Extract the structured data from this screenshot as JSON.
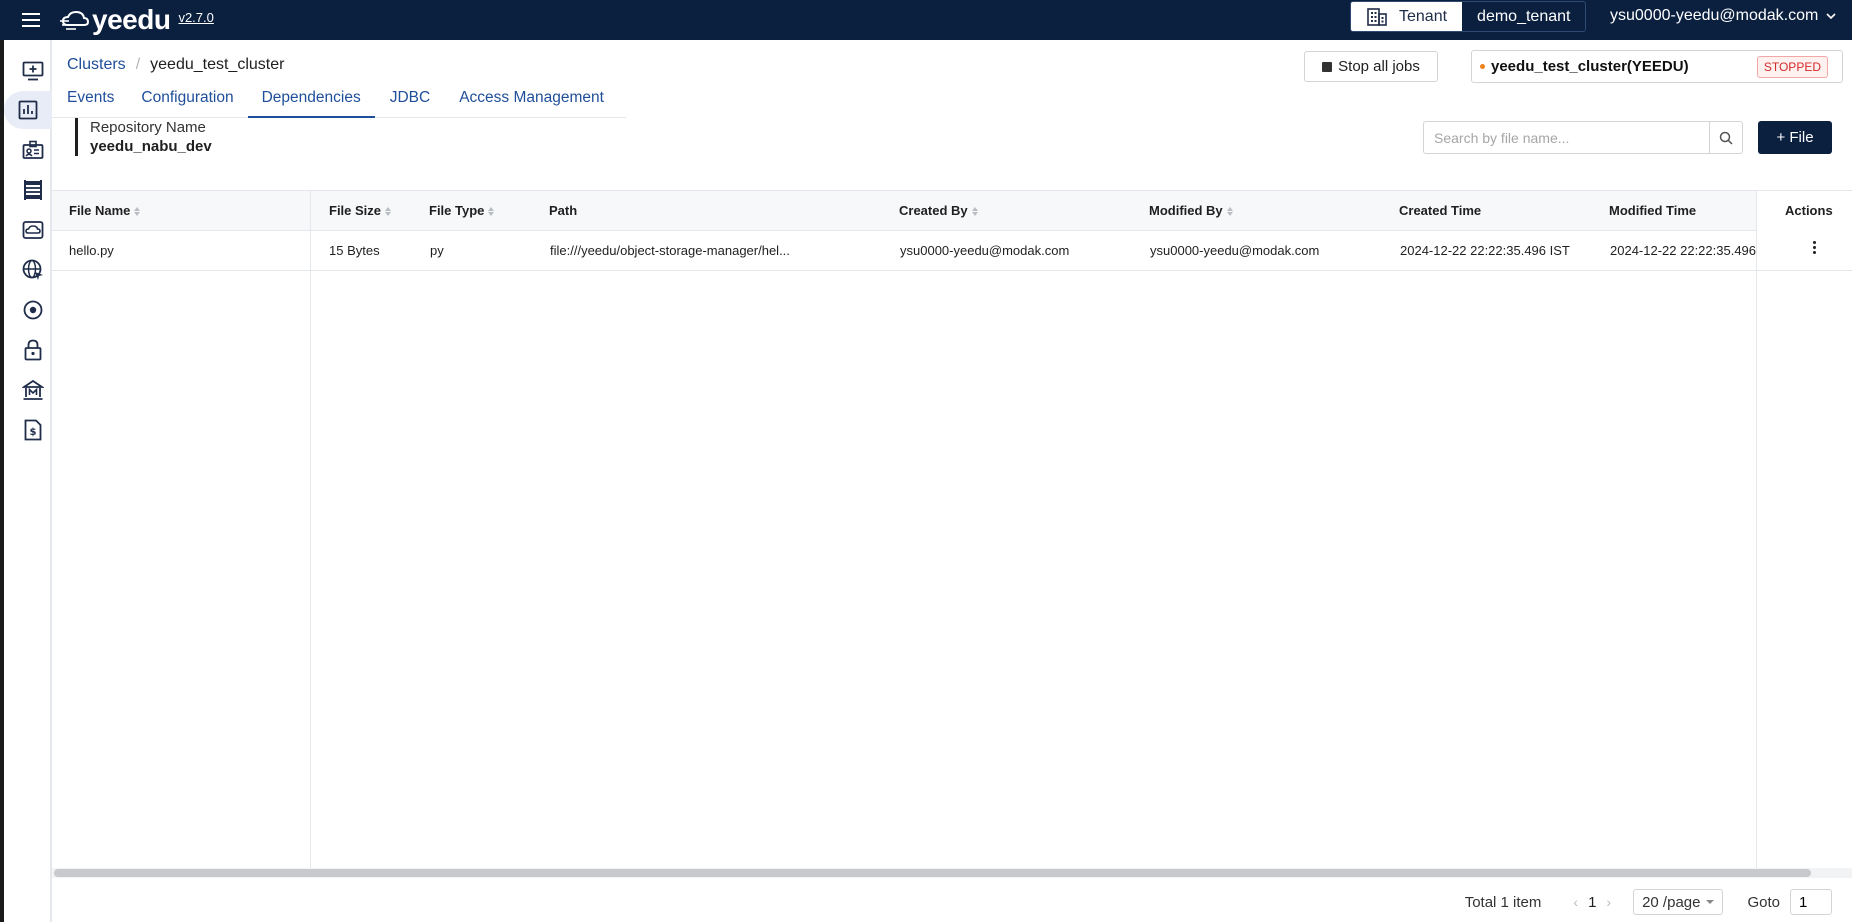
{
  "header": {
    "app_name": "yeedu",
    "version": "v2.7.0",
    "tenant_label": "Tenant",
    "tenant_name": "demo_tenant",
    "user_email": "ysu0000-yeedu@modak.com"
  },
  "sidebar": {
    "items": [
      {
        "icon": "add-screen-icon",
        "active": false
      },
      {
        "icon": "bar-chart-icon",
        "active": true
      },
      {
        "icon": "id-card-icon",
        "active": false
      },
      {
        "icon": "server-rack-icon",
        "active": false
      },
      {
        "icon": "cloud-storage-icon",
        "active": false
      },
      {
        "icon": "globe-cursor-icon",
        "active": false
      },
      {
        "icon": "target-icon",
        "active": false
      },
      {
        "icon": "lock-icon",
        "active": false
      },
      {
        "icon": "bank-icon",
        "active": false
      },
      {
        "icon": "billing-icon",
        "active": false
      }
    ]
  },
  "breadcrumb": {
    "parent": "Clusters",
    "separator": "/",
    "current": "yeedu_test_cluster"
  },
  "actions": {
    "stop_all_jobs": "Stop all jobs",
    "add_file": "+ File"
  },
  "cluster": {
    "name": "yeedu_test_cluster(YEEDU)",
    "status": "STOPPED",
    "status_color": "#d42a2a"
  },
  "tabs": [
    {
      "label": "Events",
      "active": false
    },
    {
      "label": "Configuration",
      "active": false
    },
    {
      "label": "Dependencies",
      "active": true
    },
    {
      "label": "JDBC",
      "active": false
    },
    {
      "label": "Access Management",
      "active": false
    }
  ],
  "repository": {
    "label": "Repository Name",
    "value": "yeedu_nabu_dev"
  },
  "search": {
    "placeholder": "Search by file name...",
    "value": ""
  },
  "table": {
    "columns": [
      "File Name",
      "File Size",
      "File Type",
      "Path",
      "Created By",
      "Modified By",
      "Created Time",
      "Modified Time",
      "Actions"
    ],
    "rows": [
      {
        "file_name": "hello.py",
        "file_size": "15 Bytes",
        "file_type": "py",
        "path": "file:///yeedu/object-storage-manager/hel...",
        "created_by": "ysu0000-yeedu@modak.com",
        "modified_by": "ysu0000-yeedu@modak.com",
        "created_time": "2024-12-22 22:22:35.496 IST",
        "modified_time": "2024-12-22 22:22:35.496"
      }
    ]
  },
  "pagination": {
    "total": "Total 1 item",
    "current_page": "1",
    "page_size": "20 /page",
    "goto_label": "Goto",
    "goto_value": "1"
  },
  "colors": {
    "brand_navy": "#0b1f3f",
    "link_blue": "#1f4e9b",
    "status_dot": "#f0821e"
  }
}
